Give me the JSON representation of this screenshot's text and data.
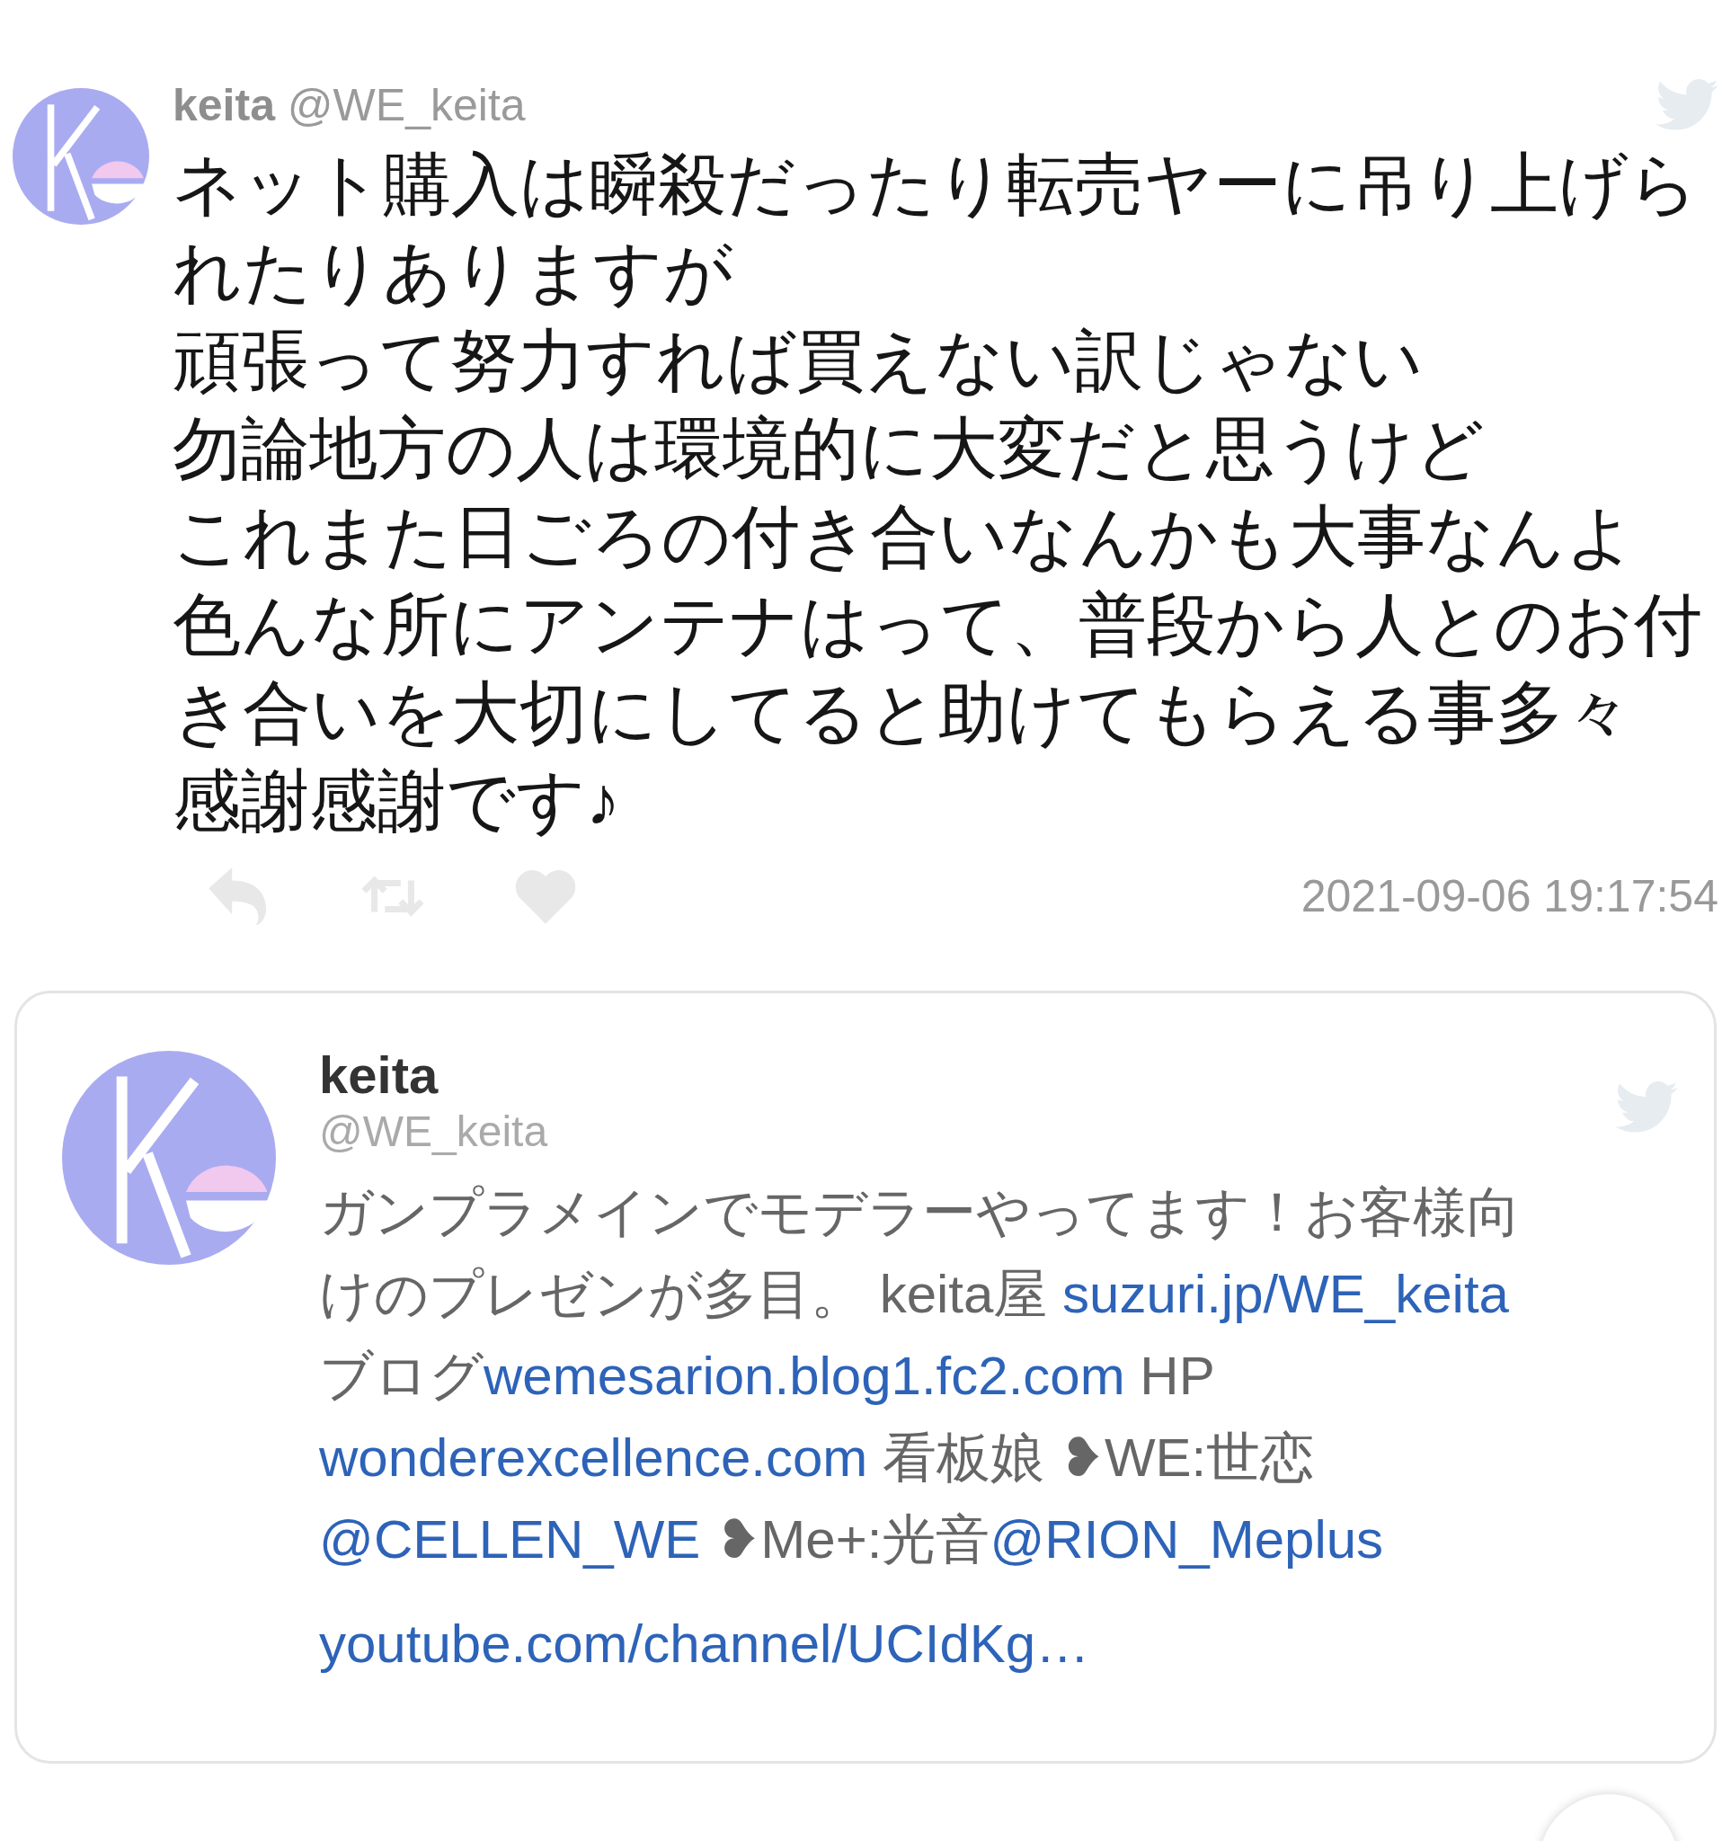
{
  "tweet": {
    "name": "keita",
    "handle": "@WE_keita",
    "text_lines": [
      "ネット購入は瞬殺だったり転売ヤーに吊り上げら",
      "れたりありますが",
      "頑張って努力すれば買えない訳じゃない",
      "勿論地方の人は環境的に大変だと思うけど",
      "これまた日ごろの付き合いなんかも大事なんよ",
      "色んな所にアンテナはって、普段から人とのお付",
      "き合いを大切にしてると助けてもらえる事多々",
      "感謝感謝です♪"
    ],
    "timestamp": "2021-09-06 19:17:54"
  },
  "profile_card": {
    "name": "keita",
    "handle": "@WE_keita",
    "bio_lines": [
      [
        {
          "kind": "text",
          "text": "ガンプラメインでモデラーやってます！お客様向"
        }
      ],
      [
        {
          "kind": "text",
          "text": "けのプレゼンが多目。 keita屋 "
        },
        {
          "kind": "link",
          "text": "suzuri.jp/WE_keita"
        }
      ],
      [
        {
          "kind": "text",
          "text": "ブログ"
        },
        {
          "kind": "link",
          "text": "wemesarion.blog1.fc2.com"
        },
        {
          "kind": "text",
          "text": " HP"
        }
      ],
      [
        {
          "kind": "link",
          "text": "wonderexcellence.com"
        },
        {
          "kind": "text",
          "text": " 看板娘 ❥WE:世恋"
        }
      ],
      [
        {
          "kind": "link",
          "text": "@CELLEN_WE"
        },
        {
          "kind": "text",
          "text": " ❥Me+:光音"
        },
        {
          "kind": "link",
          "text": "@RION_Meplus"
        }
      ]
    ],
    "url": "youtube.com/channel/UCIdKg…"
  }
}
